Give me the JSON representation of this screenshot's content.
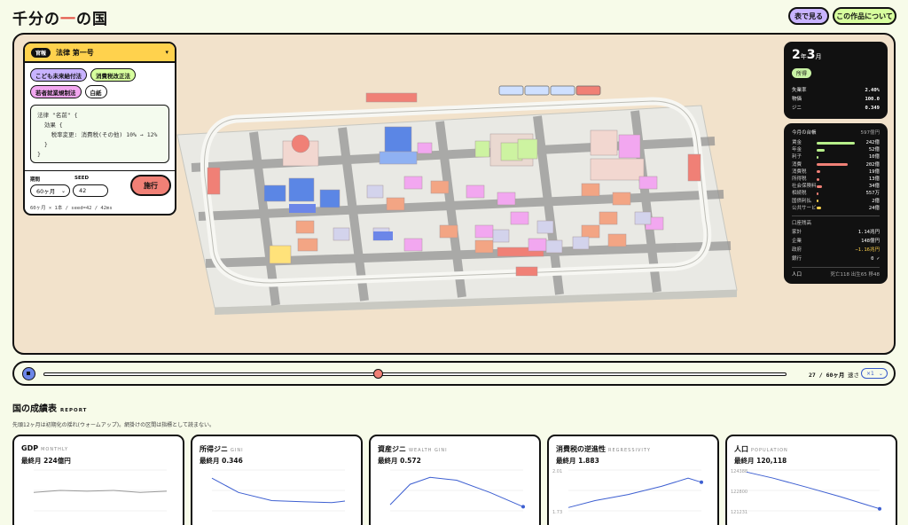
{
  "header": {
    "title_a": "千分の",
    "title_b": "一",
    "title_c": "の国",
    "btn_table": "表で見る",
    "btn_about": "この作品について"
  },
  "law": {
    "badge": "官報",
    "title": "法律 第一号",
    "chips": [
      {
        "label": "こども未来給付法",
        "color": "#c8b3ff"
      },
      {
        "label": "消費税改正法",
        "color": "#d7ff9e"
      },
      {
        "label": "若者就業規制法",
        "color": "#f2a7f0"
      },
      {
        "label": "白紙",
        "color": "#ffffff"
      }
    ],
    "code": "法律 \"名前\" {\n  効果 {\n    税率変更: 消費税(その他) 10% → 12%\n  }\n}",
    "period_label": "期間",
    "period_value": "60ヶ月",
    "seed_label": "SEED",
    "seed_value": "42",
    "run_label": "施行",
    "run_info": "60ヶ月 × 1本 / seed=42 / 42ms"
  },
  "status": {
    "year": "2",
    "year_unit": "年",
    "month": "3",
    "month_unit": "月",
    "tag": "所得",
    "rows": [
      {
        "label": "失業率",
        "value": "2.40%"
      },
      {
        "label": "物価",
        "value": "100.0"
      },
      {
        "label": "ジニ",
        "value": "0.349"
      }
    ]
  },
  "ledger": {
    "title": "今月の台帳",
    "total": "597億円",
    "rows": [
      {
        "label": "賃金",
        "value": "242億",
        "fraction": 0.82,
        "color": "#b7ef8a"
      },
      {
        "label": "年金",
        "value": "52億",
        "fraction": 0.18,
        "color": "#b7ef8a"
      },
      {
        "label": "利子",
        "value": "10億",
        "fraction": 0.04,
        "color": "#b7ef8a"
      },
      {
        "label": "消費",
        "value": "202億",
        "fraction": 0.68,
        "color": "#f08076"
      },
      {
        "label": "消費税",
        "value": "19億",
        "fraction": 0.07,
        "color": "#f08076"
      },
      {
        "label": "所得税",
        "value": "13億",
        "fraction": 0.05,
        "color": "#f08076"
      },
      {
        "label": "社会保険料",
        "value": "34億",
        "fraction": 0.12,
        "color": "#f08076"
      },
      {
        "label": "相続税",
        "value": "557万",
        "fraction": 0.01,
        "color": "#f08076"
      },
      {
        "label": "国債利払",
        "value": "2億",
        "fraction": 0.01,
        "color": "#ffd24d"
      },
      {
        "label": "公共サービ",
        "value": "24億",
        "fraction": 0.09,
        "color": "#ffd24d"
      }
    ],
    "section": "口座残高",
    "balances": [
      {
        "label": "家計",
        "value": "1.14兆円",
        "color": "#ffffff"
      },
      {
        "label": "企業",
        "value": "148億円",
        "color": "#ffffff"
      },
      {
        "label": "政府",
        "value": "−1.16兆円",
        "color": "#ffd24d"
      },
      {
        "label": "銀行",
        "value": "0 ✓",
        "color": "#ffffff"
      }
    ],
    "pop_label": "人口",
    "pop_value": "死亡118 出生65 移48"
  },
  "timeline": {
    "position": "27 / 60ヶ月",
    "progress": 0.45,
    "speed_label": "速さ",
    "speed_value": "×1"
  },
  "report": {
    "title": "国の成績表",
    "subtitle": "REPORT",
    "note": "先頭12ヶ月は初期化の揺れ(ウォームアップ)。網掛けの区間は指標として読まない。",
    "cards": [
      {
        "title": "GDP",
        "en": "MONTHLY",
        "value": "最終月 224億円",
        "ticks": []
      },
      {
        "title": "所得ジニ",
        "en": "GINI",
        "value": "最終月 0.346",
        "ticks": []
      },
      {
        "title": "資産ジニ",
        "en": "WEALTH GINI",
        "value": "最終月 0.572",
        "ticks": []
      },
      {
        "title": "消費税の逆進性",
        "en": "REGRESSIVITY",
        "value": "最終月 1.883",
        "ticks": [
          "2.01",
          "1.73"
        ]
      },
      {
        "title": "人口",
        "en": "POPULATION",
        "value": "最終月 120,118",
        "ticks": [
          "124388",
          "122800",
          "121231"
        ]
      }
    ]
  }
}
